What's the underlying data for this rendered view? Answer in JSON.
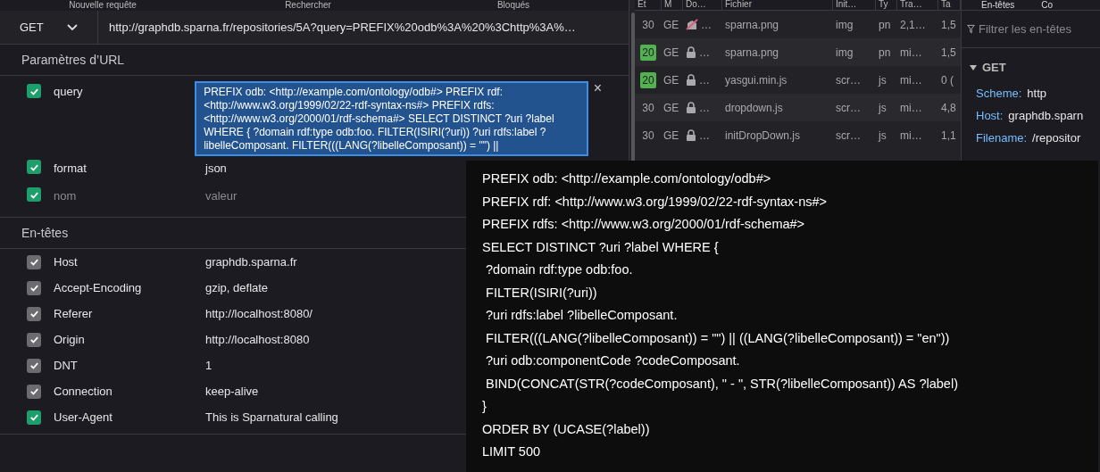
{
  "left_tabs": [
    "Nouvelle requête",
    "Rechercher",
    "Bloqués"
  ],
  "request": {
    "method": "GET",
    "url": "http://graphdb.sparna.fr/repositories/5A?query=PREFIX%20odb%3A%20%3Chttp%3A%…"
  },
  "url_params": {
    "title": "Paramètres d’URL",
    "rows": [
      {
        "kind": "textarea",
        "name": "query",
        "value": "PREFIX odb: <http://example.com/ontology/odb#> PREFIX rdf: <http://www.w3.org/1999/02/22-rdf-syntax-ns#> PREFIX rdfs: <http://www.w3.org/2000/01/rdf-schema#> SELECT DISTINCT ?uri ?label WHERE { ?domain rdf:type odb:foo. FILTER(ISIRI(?uri)) ?uri rdfs:label ?libelleComposant. FILTER(((LANG(?libelleComposant)) = \"\") ||",
        "text_selected": true,
        "checked": true,
        "remove": "×"
      },
      {
        "kind": "text",
        "name": "format",
        "value": "json",
        "checked": true
      },
      {
        "kind": "new",
        "name_placeholder": "nom",
        "value_placeholder": "valeur",
        "checked": true
      }
    ]
  },
  "headers": {
    "title": "En-têtes",
    "rows": [
      {
        "name": "Host",
        "value": "graphdb.sparna.fr",
        "checked": true,
        "disabled": true
      },
      {
        "name": "Accept-Encoding",
        "value": "gzip, deflate",
        "checked": true,
        "disabled": true
      },
      {
        "name": "Referer",
        "value": "http://localhost:8080/",
        "checked": true,
        "disabled": true
      },
      {
        "name": "Origin",
        "value": "http://localhost:8080",
        "checked": true,
        "disabled": true
      },
      {
        "name": "DNT",
        "value": "1",
        "checked": true,
        "disabled": true
      },
      {
        "name": "Connection",
        "value": "keep-alive",
        "checked": true,
        "disabled": true
      },
      {
        "name": "User-Agent",
        "value": "This is Sparnatural calling",
        "checked": true,
        "disabled": false
      }
    ]
  },
  "network": {
    "columns": [
      "Ét",
      "M",
      "Do…",
      "Fichier",
      "Init…",
      "Ty",
      "Tra…",
      "Ta"
    ],
    "rows": [
      {
        "status": "30",
        "badge": false,
        "method": "GE",
        "insecure": true,
        "domain": "…",
        "file": "sparna.png",
        "initiator": "img",
        "type": "pn",
        "transferred": "2,1…",
        "size": "1,5"
      },
      {
        "status": "20",
        "badge": true,
        "method": "GE",
        "insecure": false,
        "domain": "…",
        "file": "sparna.png",
        "initiator": "img",
        "type": "pn",
        "transferred": "mi…",
        "size": "1,5"
      },
      {
        "status": "20",
        "badge": true,
        "method": "GE",
        "insecure": false,
        "domain": "…",
        "file": "yasgui.min.js",
        "initiator": "scr…",
        "type": "js",
        "transferred": "mi…",
        "size": "0 ("
      },
      {
        "status": "30",
        "badge": false,
        "method": "GE",
        "insecure": false,
        "domain": "…",
        "file": "dropdown.js",
        "initiator": "scr…",
        "type": "js",
        "transferred": "mi…",
        "size": "4,8"
      },
      {
        "status": "30",
        "badge": false,
        "method": "GE",
        "insecure": false,
        "domain": "…",
        "file": "initDropDown.js",
        "initiator": "scr…",
        "type": "js",
        "transferred": "mi…",
        "size": "1,1"
      }
    ]
  },
  "details": {
    "tabs": [
      "En-têtes",
      "Co"
    ],
    "filter_placeholder": "Filtrer les en-têtes",
    "section": "GET",
    "expanded": true,
    "fields": [
      {
        "label": "Scheme:",
        "value": "http"
      },
      {
        "label": "Host:",
        "value": "graphdb.sparn"
      },
      {
        "label": "Filename:",
        "value": "/repositor"
      }
    ]
  },
  "tooltip": {
    "lines": [
      "PREFIX odb: <http://example.com/ontology/odb#>",
      "PREFIX rdf: <http://www.w3.org/1999/02/22-rdf-syntax-ns#>",
      "PREFIX rdfs: <http://www.w3.org/2000/01/rdf-schema#>",
      "SELECT DISTINCT ?uri ?label WHERE {",
      " ?domain rdf:type odb:foo.",
      " FILTER(ISIRI(?uri))",
      " ?uri rdfs:label ?libelleComposant.",
      " FILTER(((LANG(?libelleComposant)) = \"\") || ((LANG(?libelleComposant)) = \"en\"))",
      " ?uri odb:componentCode ?codeComposant.",
      " BIND(CONCAT(STR(?codeComposant), \" - \", STR(?libelleComposant)) AS ?label)",
      "}",
      "ORDER BY (UCASE(?label))",
      "LIMIT 500"
    ]
  }
}
